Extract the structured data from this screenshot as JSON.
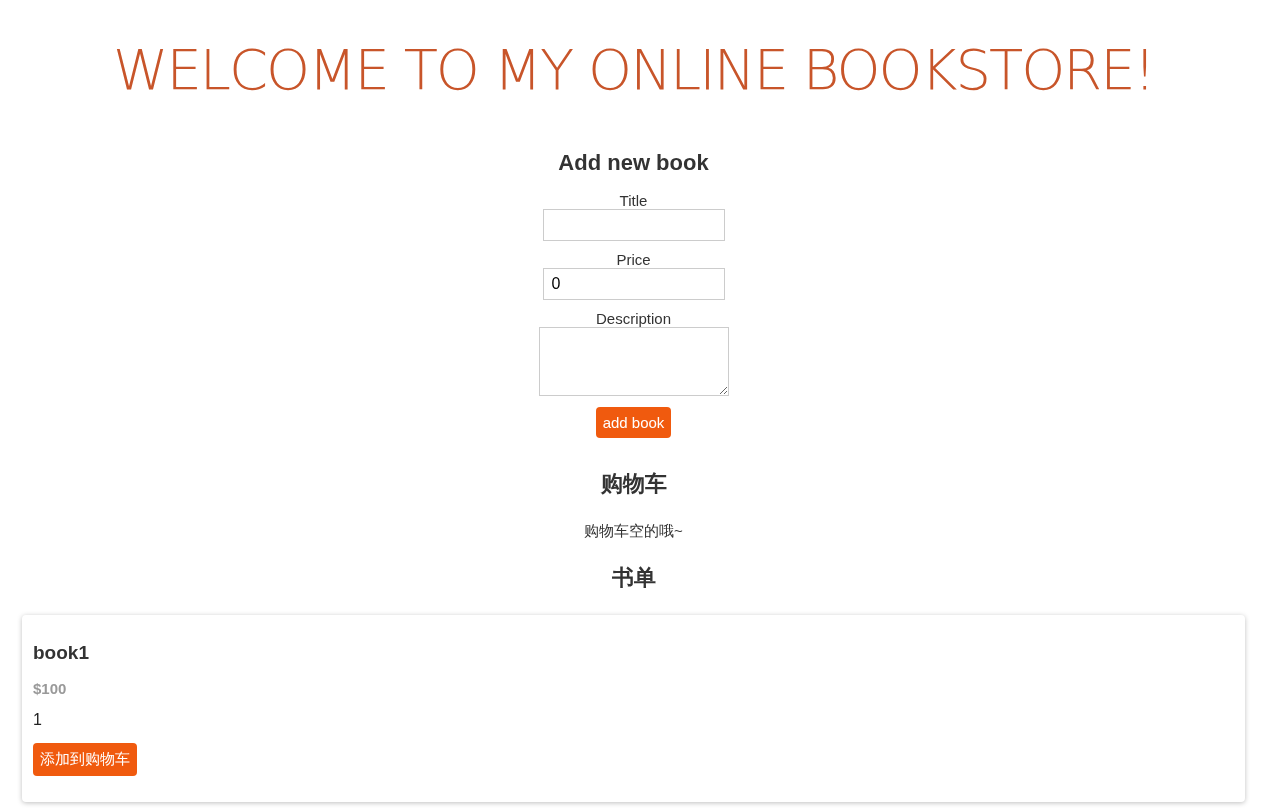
{
  "header": {
    "title": "WELCOME TO MY ONLINE BOOKSTORE!"
  },
  "add_form": {
    "heading": "Add new book",
    "fields": [
      {
        "label": "Title",
        "kind": "input"
      },
      {
        "label": "Price",
        "kind": "input",
        "value": "0"
      },
      {
        "label": "Description",
        "kind": "textarea"
      }
    ],
    "button": "add book"
  },
  "cart": {
    "heading": "购物车",
    "empty_message": "购物车空的哦~"
  },
  "book_list": {
    "heading": "书单",
    "books": [
      {
        "title": "book1",
        "price": "$100",
        "description": "1",
        "button": "添加到购物车"
      }
    ]
  }
}
